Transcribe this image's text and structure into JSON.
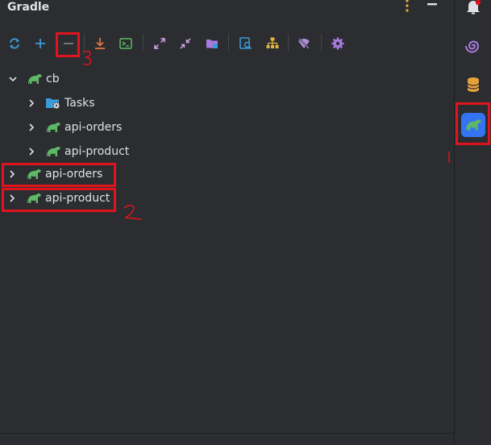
{
  "panel": {
    "title": "Gradle"
  },
  "toolbar": {
    "buttons": [
      {
        "icon": "refresh-icon",
        "color": "#3e9bd9"
      },
      {
        "icon": "plus-icon",
        "color": "#3e9bd9"
      },
      {
        "icon": "minus-icon",
        "color": "#7a7e85"
      },
      {
        "icon": "download-icon",
        "color": "#e0763d"
      },
      {
        "icon": "terminal-icon",
        "color": "#5fb865"
      },
      {
        "icon": "expand-icon",
        "color": "#d7a6f0"
      },
      {
        "icon": "collapse-icon",
        "color": "#d7a6f0"
      },
      {
        "icon": "folder-icon",
        "color": "#a87be0"
      },
      {
        "icon": "search-icon",
        "color": "#3e9bd9"
      },
      {
        "icon": "hierarchy-icon",
        "color": "#e3b341"
      },
      {
        "icon": "offline-icon",
        "color": "#b08fd8"
      },
      {
        "icon": "settings-icon",
        "color": "#a87be0"
      }
    ]
  },
  "tree": {
    "root": {
      "label": "cb",
      "expanded": true
    },
    "children": [
      {
        "label": "Tasks",
        "icon": "folder-gear-icon"
      },
      {
        "label": "api-orders",
        "icon": "gradle-icon"
      },
      {
        "label": "api-product",
        "icon": "gradle-icon"
      }
    ],
    "top_level": [
      {
        "label": "api-orders",
        "icon": "gradle-icon"
      },
      {
        "label": "api-product",
        "icon": "gradle-icon"
      }
    ]
  },
  "stripe": {
    "items": [
      {
        "icon": "notifications-icon"
      },
      {
        "icon": "spiral-icon"
      },
      {
        "icon": "database-icon"
      },
      {
        "icon": "gradle-icon",
        "active": true
      }
    ]
  },
  "colors": {
    "background": "#2b2d30",
    "gradle_green": "#5fb865",
    "annotation_red": "#e0141e",
    "active_blue": "#3574f0"
  }
}
